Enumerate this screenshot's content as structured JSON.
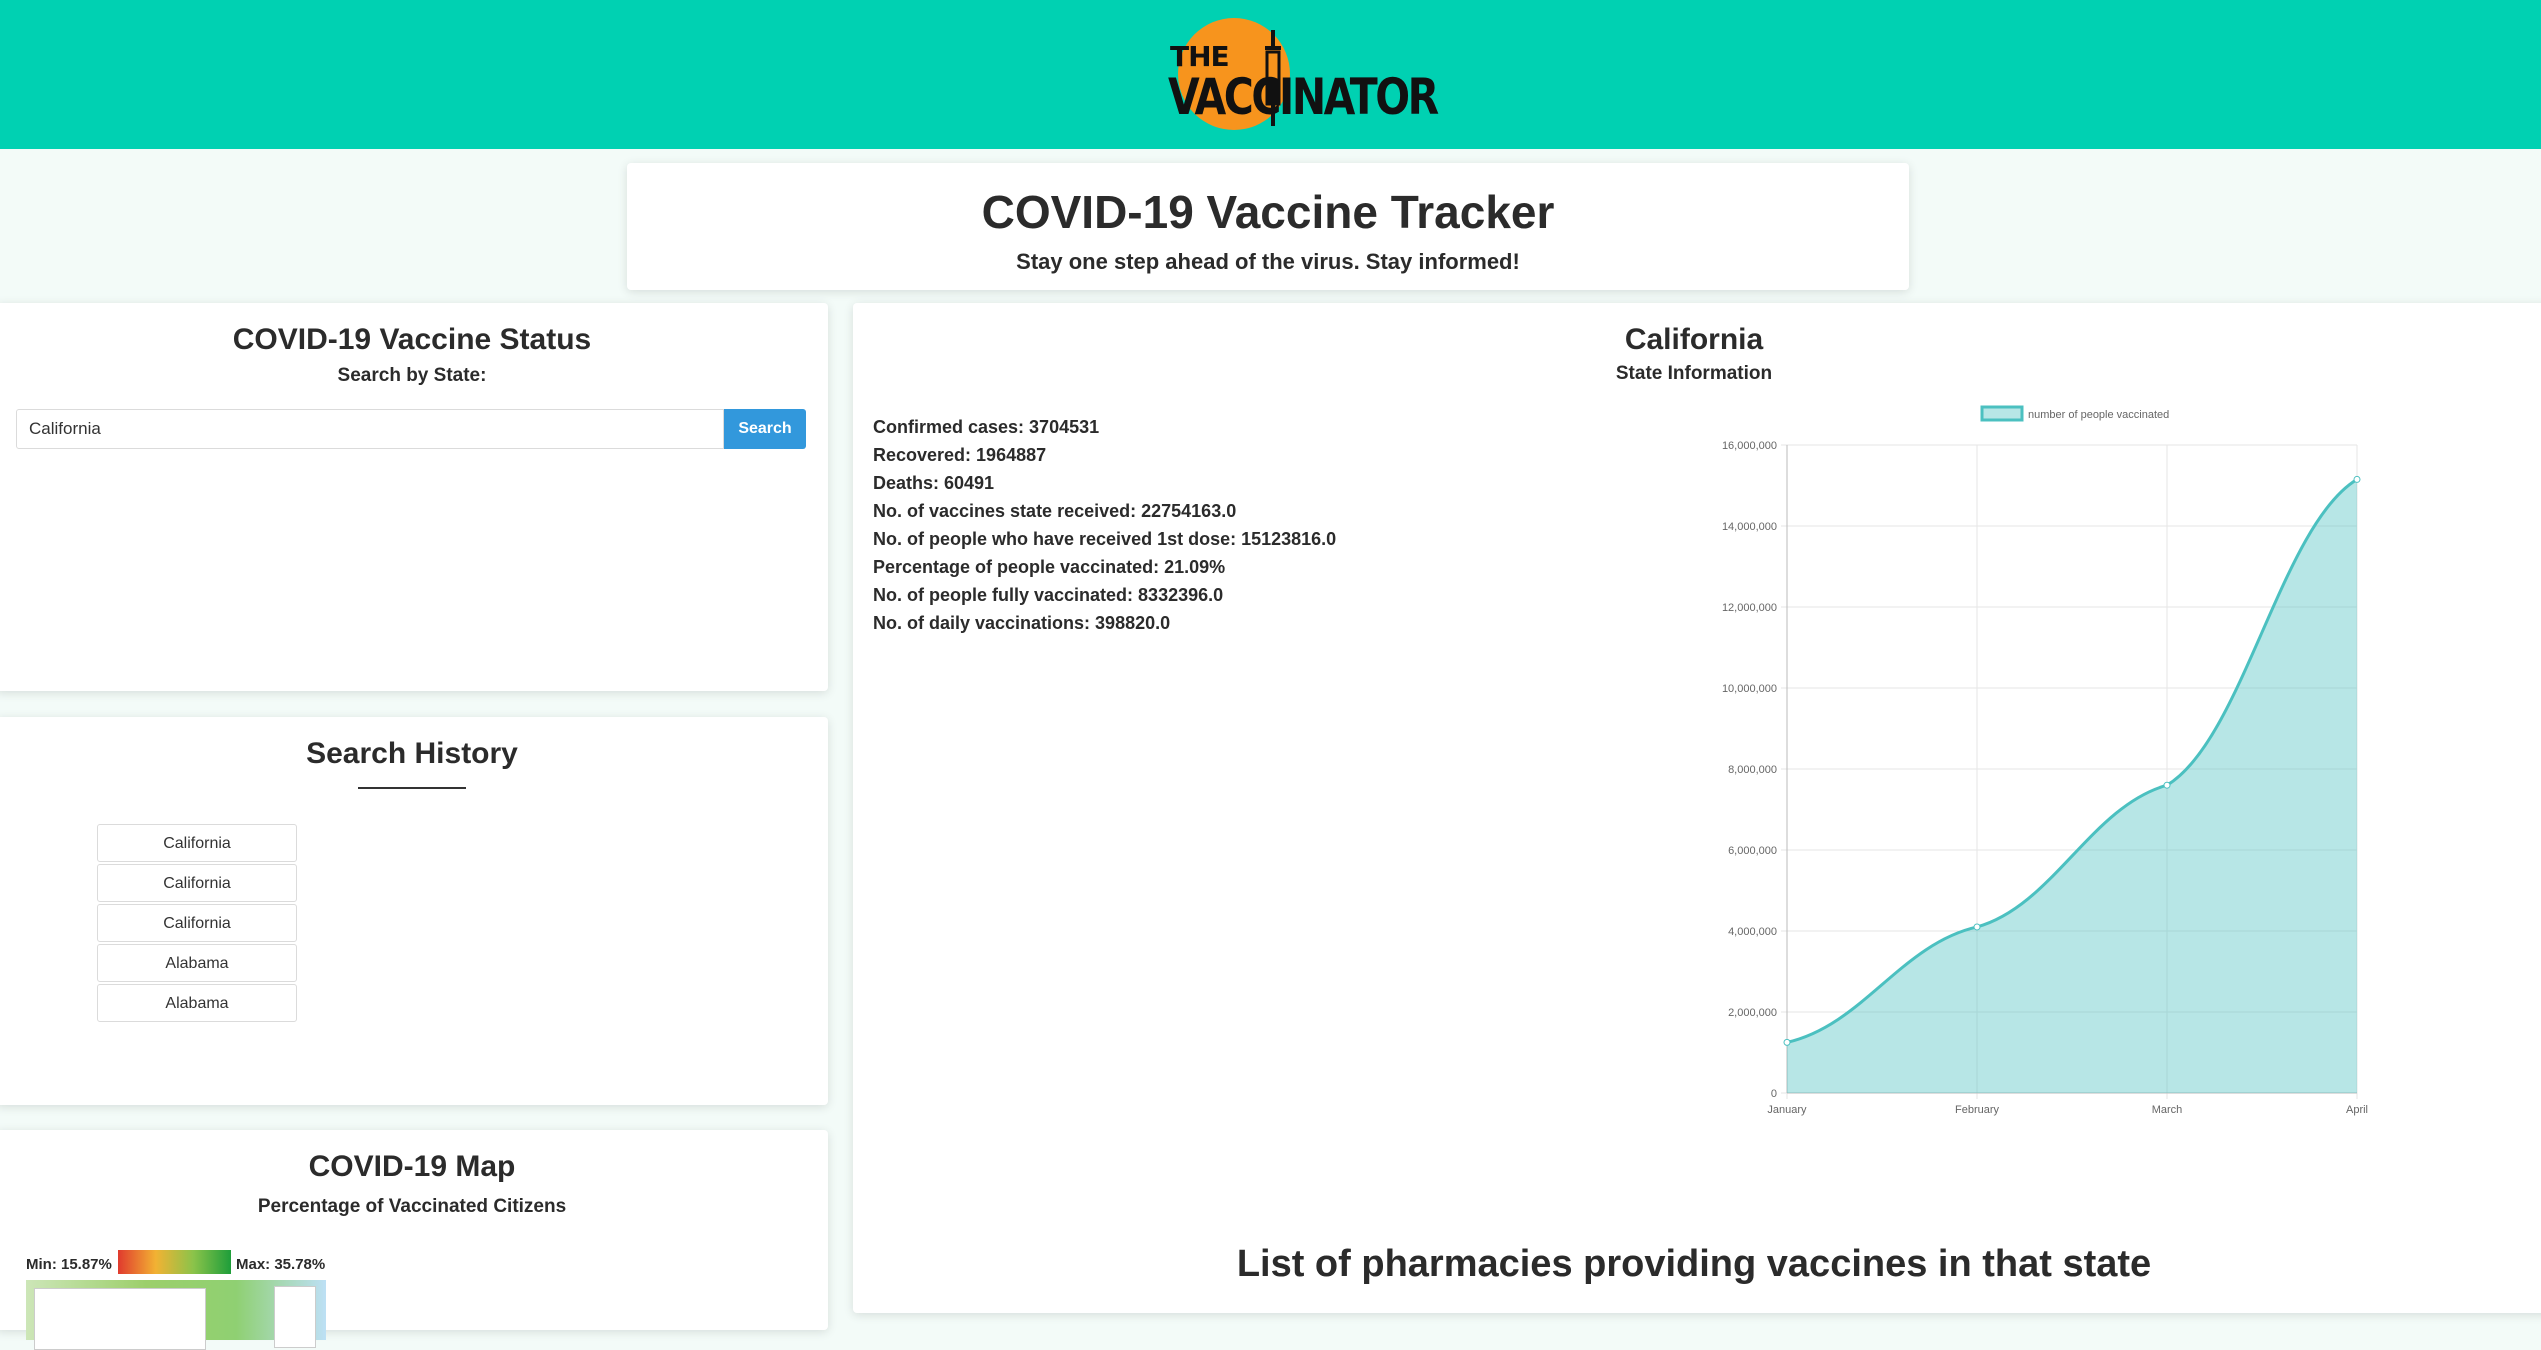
{
  "header": {
    "logo_line1": "THE",
    "logo_line2": "VACCINATOR",
    "brand_color": "#00d1b2",
    "logo_circle_color": "#f7941d"
  },
  "hero": {
    "title": "COVID-19 Vaccine Tracker",
    "subtitle": "Stay one step ahead of the virus. Stay informed!"
  },
  "status_panel": {
    "title": "COVID-19 Vaccine Status",
    "subtitle": "Search by State:",
    "search_value": "California",
    "search_button": "Search",
    "button_color": "#3298dc"
  },
  "history_panel": {
    "title": "Search History",
    "items": [
      "California",
      "California",
      "California",
      "Alabama",
      "Alabama"
    ]
  },
  "map_panel": {
    "title": "COVID-19 Map",
    "subtitle": "Percentage of Vaccinated Citizens",
    "min_label": "Min: 15.87%",
    "max_label": "Max: 35.78%"
  },
  "state_panel": {
    "state_name": "California",
    "subtitle": "State Information",
    "stats": [
      "Confirmed cases: 3704531",
      "Recovered: 1964887",
      "Deaths: 60491",
      "No. of vaccines state received: 22754163.0",
      "No. of people who have received 1st dose: 15123816.0",
      "Percentage of people vaccinated: 21.09%",
      "No. of people fully vaccinated: 8332396.0",
      "No. of daily vaccinations: 398820.0"
    ],
    "pharmacies_heading": "List of pharmacies providing vaccines in that state"
  },
  "chart_data": {
    "type": "area",
    "categories": [
      "January",
      "February",
      "March",
      "April"
    ],
    "series": [
      {
        "name": "number of people vaccinated",
        "values": [
          1250000,
          4100000,
          7600000,
          15150000
        ],
        "color": "#4bc0c0"
      }
    ],
    "ylim": [
      0,
      16000000
    ],
    "yticks": [
      0,
      2000000,
      4000000,
      6000000,
      8000000,
      10000000,
      12000000,
      14000000,
      16000000
    ],
    "ytick_labels": [
      "0",
      "2,000,000",
      "4,000,000",
      "6,000,000",
      "8,000,000",
      "10,000,000",
      "12,000,000",
      "14,000,000",
      "16,000,000"
    ],
    "grid": true,
    "legend": "top"
  }
}
